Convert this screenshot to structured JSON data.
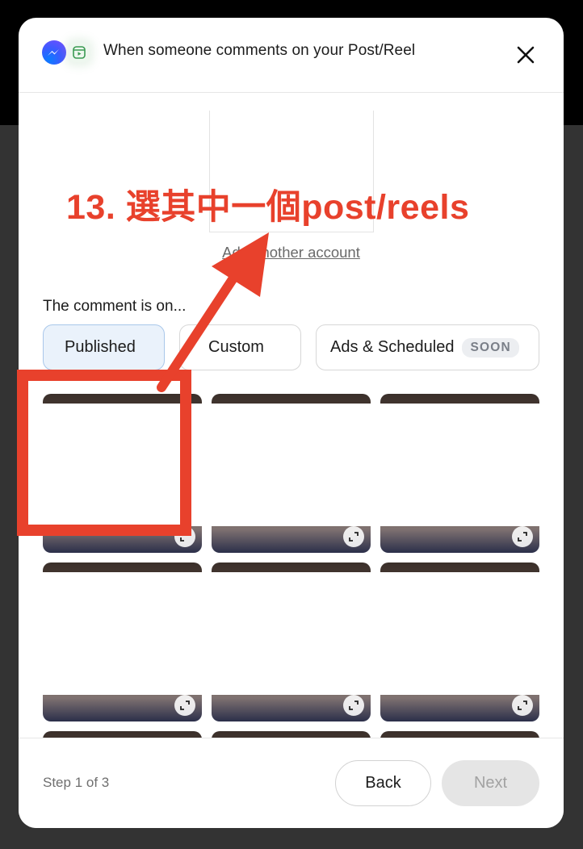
{
  "modal": {
    "title": "When someone comments on your Post/Reel",
    "icons": [
      "messenger-icon",
      "reel-icon",
      "close-icon"
    ]
  },
  "account": {
    "add_account_link": "Add another account"
  },
  "annotation": {
    "text": "13. 選其中一個post/reels",
    "color": "#e8412c"
  },
  "source": {
    "question": "The comment is on...",
    "tabs": [
      {
        "label": "Published",
        "active": true
      },
      {
        "label": "Custom",
        "active": false
      },
      {
        "label": "Ads & Scheduled",
        "badge": "SOON",
        "active": false
      }
    ]
  },
  "posts": {
    "rows_visible": 2,
    "columns": 3,
    "selected_index": 0
  },
  "footer": {
    "step": "Step 1 of 3",
    "back_label": "Back",
    "next_label": "Next"
  }
}
